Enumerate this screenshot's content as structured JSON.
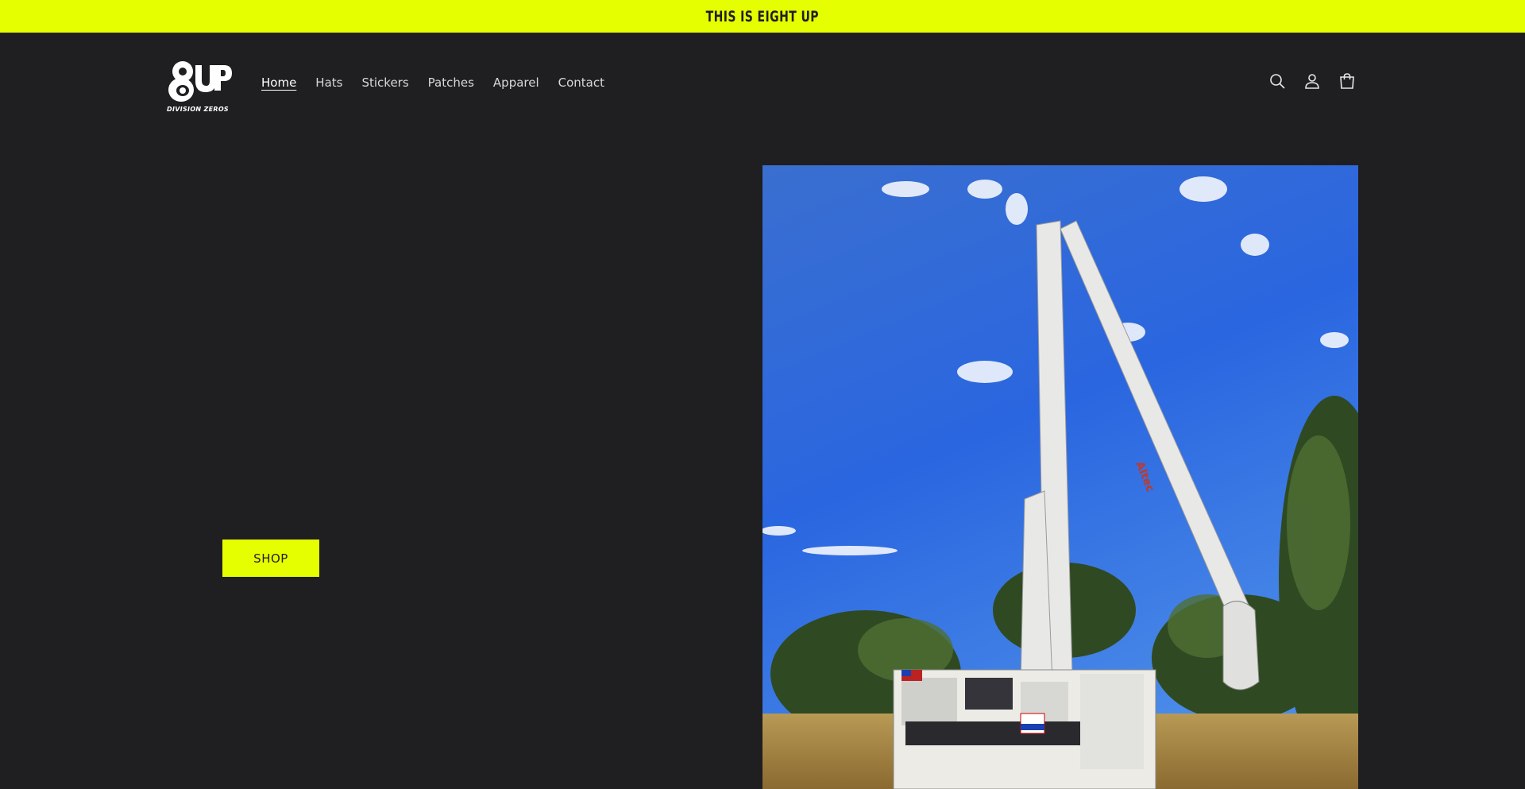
{
  "announcement": {
    "text": "THIS IS EIGHT UP"
  },
  "header": {
    "logo": {
      "main": "8UP",
      "tagline": "DIVISION ZEROS"
    },
    "nav": [
      {
        "label": "Home",
        "active": true
      },
      {
        "label": "Hats",
        "active": false
      },
      {
        "label": "Stickers",
        "active": false
      },
      {
        "label": "Patches",
        "active": false
      },
      {
        "label": "Apparel",
        "active": false
      },
      {
        "label": "Contact",
        "active": false
      }
    ],
    "icons": [
      "search-icon",
      "account-icon",
      "cart-icon"
    ]
  },
  "hero": {
    "button_label": "SHOP",
    "image": {
      "subject": "bucket-truck-photo",
      "truck_brand": "Altec"
    }
  },
  "colors": {
    "accent": "#e6ff00",
    "background": "#1f1f21",
    "text": "#ffffff"
  }
}
